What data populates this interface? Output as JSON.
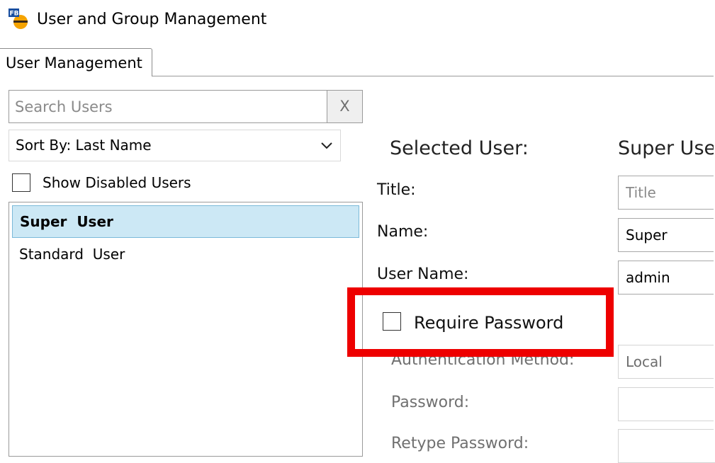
{
  "window": {
    "title": "User and Group Management",
    "app_icon_letters": "FB"
  },
  "tabs": [
    {
      "label": "User Management",
      "active": true
    }
  ],
  "search": {
    "placeholder": "Search Users",
    "value": "",
    "clear_label": "X"
  },
  "sort": {
    "selected": "Sort By: Last Name"
  },
  "show_disabled": {
    "label": "Show Disabled Users",
    "checked": false
  },
  "users": [
    {
      "name": "Super  User",
      "selected": true
    },
    {
      "name": "Standard  User",
      "selected": false
    }
  ],
  "detail": {
    "selected_user_label": "Selected User:",
    "selected_user_value": "Super User",
    "title_label": "Title:",
    "title_placeholder": "Title",
    "name_label": "Name:",
    "name_value": "Super",
    "username_label": "User Name:",
    "username_value": "admin",
    "require_password_label": "Require Password",
    "require_password_checked": false,
    "auth_method_label": "Authentication Method:",
    "auth_method_value": "Local",
    "password_label": "Password:",
    "retype_password_label": "Retype Password:"
  },
  "colors": {
    "highlight": "#ee0000",
    "selection": "#cce8f5",
    "icon_blue": "#1a4fa0",
    "icon_orange": "#f5a300"
  }
}
